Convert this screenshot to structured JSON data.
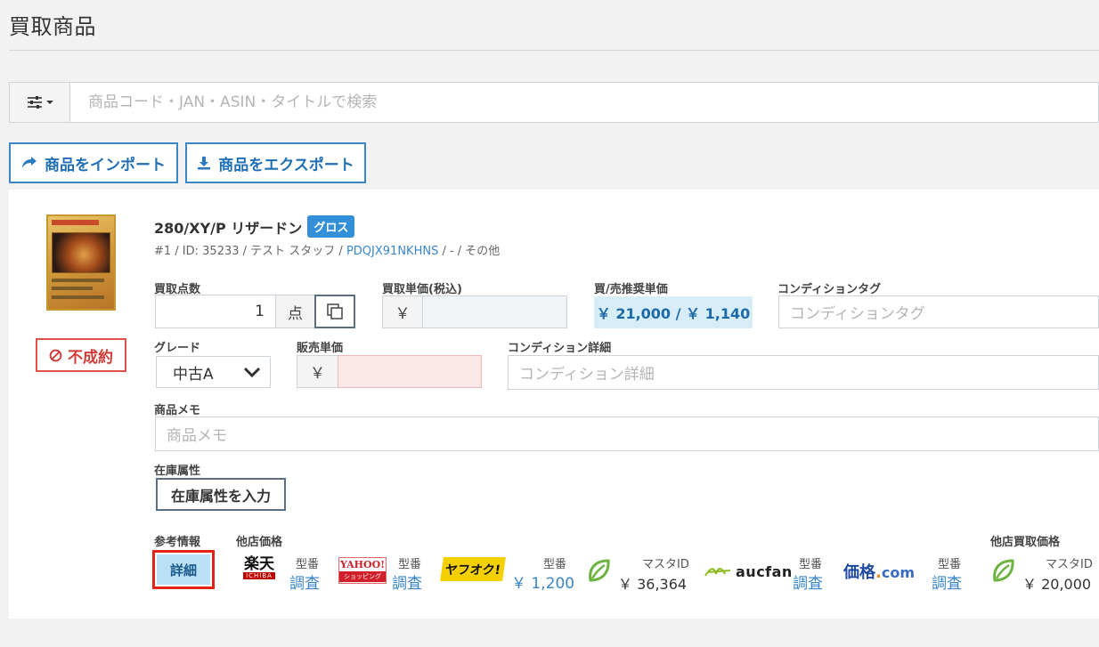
{
  "page": {
    "title": "買取商品"
  },
  "search": {
    "placeholder": "商品コード・JAN・ASIN・タイトルで検索"
  },
  "actions": {
    "import_label": "商品をインポート",
    "export_label": "商品をエクスポート"
  },
  "product": {
    "name": "280/XY/P リザードン",
    "badge": "グロス",
    "meta_prefix": "#1 / ID: 35233 / テスト スタッフ / ",
    "meta_code": "PDQJX91NKHNS",
    "meta_suffix": " / - / その他",
    "not_deal_label": "不成約"
  },
  "form": {
    "qty_label": "買取点数",
    "qty_value": "1",
    "qty_unit": "点",
    "buy_price_label": "買取単価(税込)",
    "buy_price_prefix": "￥",
    "buy_price_value": "",
    "recommend_label": "買/売推奨単価",
    "recommend_value": "￥ 21,000 / ￥ 1,140",
    "cond_tag_label": "コンディションタグ",
    "cond_tag_placeholder": "コンディションタグ",
    "grade_label": "グレード",
    "grade_value": "中古A",
    "sell_price_label": "販売単価",
    "sell_price_prefix": "￥",
    "sell_price_value": "",
    "cond_detail_label": "コンディション詳細",
    "cond_detail_placeholder": "コンディション詳細",
    "memo_label": "商品メモ",
    "memo_placeholder": "商品メモ",
    "attr_label": "在庫属性",
    "attr_button": "在庫属性を入力"
  },
  "reference": {
    "ref_label": "参考情報",
    "detail_button": "詳細",
    "other_price_label": "他店価格",
    "other_buy_label": "他店買取価格",
    "rakuten": {
      "logo_main": "楽天",
      "logo_sub": "ICHIBA",
      "label": "型番",
      "value": "調査"
    },
    "yahoo": {
      "logo_main": "YAHOO!",
      "logo_sub": "ショッピング",
      "label": "型番",
      "value": "調査"
    },
    "yafuoku": {
      "logo": "ヤフオク!",
      "label": "型番",
      "value": "￥ 1,200"
    },
    "leaf1": {
      "label": "マスタID",
      "value": "￥ 36,364"
    },
    "aucfan": {
      "logo": "aucfan",
      "label": "型番",
      "value": "調査"
    },
    "kakaku": {
      "logo_main": "価格",
      "logo_dot": ".",
      "logo_com": "com",
      "label": "型番",
      "value": "調査"
    },
    "leaf2": {
      "label": "マスタID",
      "value": "￥ 20,000"
    }
  },
  "colors": {
    "accent": "#3a86c8",
    "danger": "#e0504a",
    "recommend_bg": "#d7eef9",
    "sell_price_bg": "#fde8e8"
  }
}
